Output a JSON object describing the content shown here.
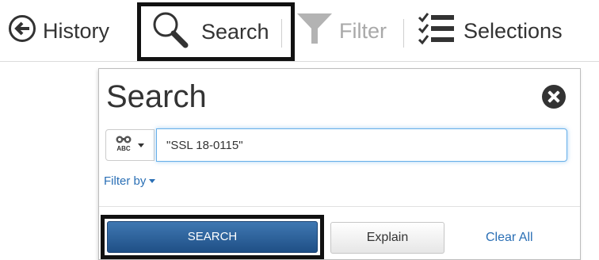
{
  "toolbar": {
    "history_label": "History",
    "search_label": "Search",
    "filter_label": "Filter",
    "selections_label": "Selections",
    "icons": {
      "history": "arrow-left-circle-icon",
      "search": "magnifier-icon",
      "filter": "funnel-icon",
      "selections": "checklist-icon"
    }
  },
  "panel": {
    "title": "Search",
    "mode_icon": "binoculars-abc-icon",
    "search_value": "\"SSL 18-0115\"",
    "filter_by_label": "Filter by",
    "search_button_label": "SEARCH",
    "explain_button_label": "Explain",
    "clear_all_label": "Clear All"
  },
  "colors": {
    "primary_button": "#2a5f99",
    "link": "#2a6fb5",
    "filter_disabled": "#a9a9a9",
    "input_focus": "#66afe9",
    "highlight_outline": "#111111"
  }
}
